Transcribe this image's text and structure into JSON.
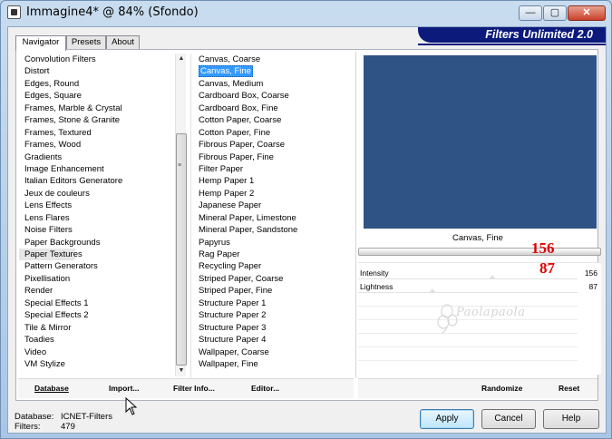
{
  "window": {
    "title": "Immagine4* @  84% (Sfondo)",
    "minimize": "—",
    "maximize": "▢",
    "close": "✕"
  },
  "tabs": [
    {
      "label": "Navigator",
      "active": true
    },
    {
      "label": "Presets",
      "active": false
    },
    {
      "label": "About",
      "active": false
    }
  ],
  "brand": "Filters Unlimited 2.0",
  "categories": [
    "Convolution Filters",
    "Distort",
    "Edges, Round",
    "Edges, Square",
    "Frames, Marble & Crystal",
    "Frames, Stone & Granite",
    "Frames, Textured",
    "Frames, Wood",
    "Gradients",
    "Image Enhancement",
    "Italian Editors Generatore",
    "Jeux de couleurs",
    "Lens Effects",
    "Lens Flares",
    "Noise Filters",
    "Paper Backgrounds",
    "Paper Textures",
    "Pattern Generators",
    "Pixellisation",
    "Render",
    "Special Effects 1",
    "Special Effects 2",
    "Tile & Mirror",
    "Toadies",
    "Video",
    "VM Stylize"
  ],
  "selected_category": "Paper Textures",
  "filters": [
    "Canvas, Coarse",
    "Canvas, Fine",
    "Canvas, Medium",
    "Cardboard Box, Coarse",
    "Cardboard Box, Fine",
    "Cotton Paper, Coarse",
    "Cotton Paper, Fine",
    "Fibrous Paper, Coarse",
    "Fibrous Paper, Fine",
    "Filter Paper",
    "Hemp Paper 1",
    "Hemp Paper 2",
    "Japanese Paper",
    "Mineral Paper, Limestone",
    "Mineral Paper, Sandstone",
    "Papyrus",
    "Rag Paper",
    "Recycling Paper",
    "Striped Paper, Coarse",
    "Striped Paper, Fine",
    "Structure Paper 1",
    "Structure Paper 2",
    "Structure Paper 3",
    "Structure Paper 4",
    "Wallpaper, Coarse",
    "Wallpaper, Fine"
  ],
  "selected_filter": "Canvas, Fine",
  "preview": {
    "label": "Canvas, Fine",
    "color": "#2f5384"
  },
  "params": [
    {
      "name": "Intensity",
      "value": "156",
      "level": 0.61
    },
    {
      "name": "Lightness",
      "value": "87",
      "level": 0.34
    }
  ],
  "annotations": {
    "intensity_big": "156",
    "lightness_big": "87",
    "color": "#e00000"
  },
  "watermark": "Paolapaola",
  "bottom_left_buttons": {
    "database": "Database",
    "import": "Import...",
    "filter_info": "Filter Info...",
    "editor": "Editor..."
  },
  "bottom_right_buttons": {
    "randomize": "Randomize",
    "reset": "Reset"
  },
  "footer": {
    "database_label": "Database:",
    "database_value": "ICNET-Filters",
    "filters_label": "Filters:",
    "filters_value": "479"
  },
  "actions": {
    "apply": "Apply",
    "cancel": "Cancel",
    "help": "Help"
  }
}
